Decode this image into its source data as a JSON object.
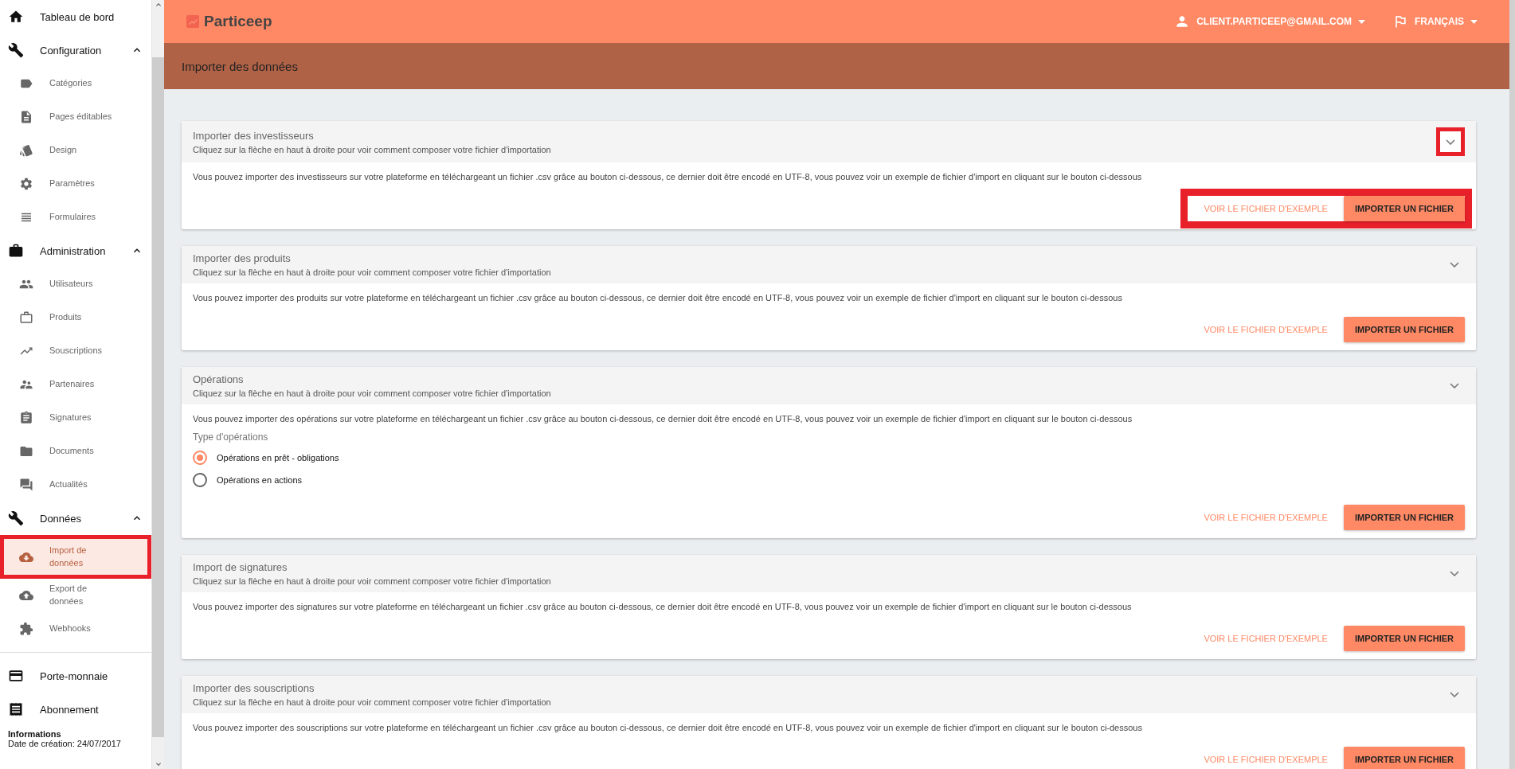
{
  "sidebar": {
    "items": [
      {
        "label": "Tableau de bord"
      },
      {
        "label": "Configuration",
        "expanded": true,
        "children": [
          {
            "label": "Catégories",
            "selected": false
          },
          {
            "label": "Pages éditables",
            "selected": false
          },
          {
            "label": "Design",
            "selected": false
          },
          {
            "label": "Paramètres",
            "selected": false
          },
          {
            "label": "Formulaires",
            "selected": false
          }
        ]
      },
      {
        "label": "Administration",
        "expanded": true,
        "children": [
          {
            "label": "Utilisateurs",
            "selected": false
          },
          {
            "label": "Produits",
            "selected": false
          },
          {
            "label": "Souscriptions",
            "selected": false
          },
          {
            "label": "Partenaires",
            "selected": false
          },
          {
            "label": "Signatures",
            "selected": false
          },
          {
            "label": "Documents",
            "selected": false
          },
          {
            "label": "Actualités",
            "selected": false
          }
        ]
      },
      {
        "label": "Données",
        "expanded": true,
        "children": [
          {
            "label": "Import de données",
            "selected": true,
            "highlighted": true
          },
          {
            "label": "Export de données",
            "selected": false
          },
          {
            "label": "Webhooks",
            "selected": false
          }
        ]
      }
    ],
    "footer_items": [
      {
        "label": "Porte-monnaie"
      },
      {
        "label": "Abonnement"
      }
    ],
    "info": {
      "title": "Informations",
      "text": "Date de création: 24/07/2017"
    }
  },
  "topbar": {
    "logo": "Particeep",
    "user": "CLIENT.PARTICEEP@GMAIL.COM",
    "language": "FRANÇAIS"
  },
  "page_title": "Importer des données",
  "cards": [
    {
      "title": "Importer des investisseurs",
      "subtitle": "Cliquez sur la flèche en haut à droite pour voir comment composer votre fichier d'importation",
      "description": "Vous pouvez importer des investisseurs sur votre plateforme en téléchargeant un fichier .csv grâce au bouton ci-dessous, ce dernier doit être encodé en UTF-8, vous pouvez voir un exemple de fichier d'import en cliquant sur le bouton ci-dessous",
      "example_button": "VOIR LE FICHIER D'EXEMPLE",
      "import_button": "IMPORTER UN FICHIER",
      "highlighted": true
    },
    {
      "title": "Importer des produits",
      "subtitle": "Cliquez sur la flèche en haut à droite pour voir comment composer votre fichier d'importation",
      "description": "Vous pouvez importer des produits sur votre plateforme en téléchargeant un fichier .csv grâce au bouton ci-dessous, ce dernier doit être encodé en UTF-8, vous pouvez voir un exemple de fichier d'import en cliquant sur le bouton ci-dessous",
      "example_button": "VOIR LE FICHIER D'EXEMPLE",
      "import_button": "IMPORTER UN FICHIER",
      "highlighted": false
    },
    {
      "title": "Opérations",
      "subtitle": "Cliquez sur la flèche en haut à droite pour voir comment composer votre fichier d'importation",
      "description": "Vous pouvez importer des opérations sur votre plateforme en téléchargeant un fichier .csv grâce au bouton ci-dessous, ce dernier doit être encodé en UTF-8, vous pouvez voir un exemple de fichier d'import en cliquant sur le bouton ci-dessous",
      "options": {
        "label": "Type d'opérations",
        "choices": [
          {
            "label": "Opérations en prêt - obligations",
            "selected": true
          },
          {
            "label": "Opérations en actions",
            "selected": false
          }
        ]
      },
      "example_button": "VOIR LE FICHIER D'EXEMPLE",
      "import_button": "IMPORTER UN FICHIER",
      "highlighted": false
    },
    {
      "title": "Import de signatures",
      "subtitle": "Cliquez sur la flèche en haut à droite pour voir comment composer votre fichier d'importation",
      "description": "Vous pouvez importer des signatures sur votre plateforme en téléchargeant un fichier .csv grâce au bouton ci-dessous, ce dernier doit être encodé en UTF-8, vous pouvez voir un exemple de fichier d'import en cliquant sur le bouton ci-dessous",
      "example_button": "VOIR LE FICHIER D'EXEMPLE",
      "import_button": "IMPORTER UN FICHIER",
      "highlighted": false
    },
    {
      "title": "Importer des souscriptions",
      "subtitle": "Cliquez sur la flèche en haut à droite pour voir comment composer votre fichier d'importation",
      "description": "Vous pouvez importer des souscriptions sur votre plateforme en téléchargeant un fichier .csv grâce au bouton ci-dessous, ce dernier doit être encodé en UTF-8, vous pouvez voir un exemple de fichier d'import en cliquant sur le bouton ci-dessous",
      "example_button": "VOIR LE FICHIER D'EXEMPLE",
      "import_button": "IMPORTER UN FICHIER",
      "highlighted": false
    }
  ]
}
